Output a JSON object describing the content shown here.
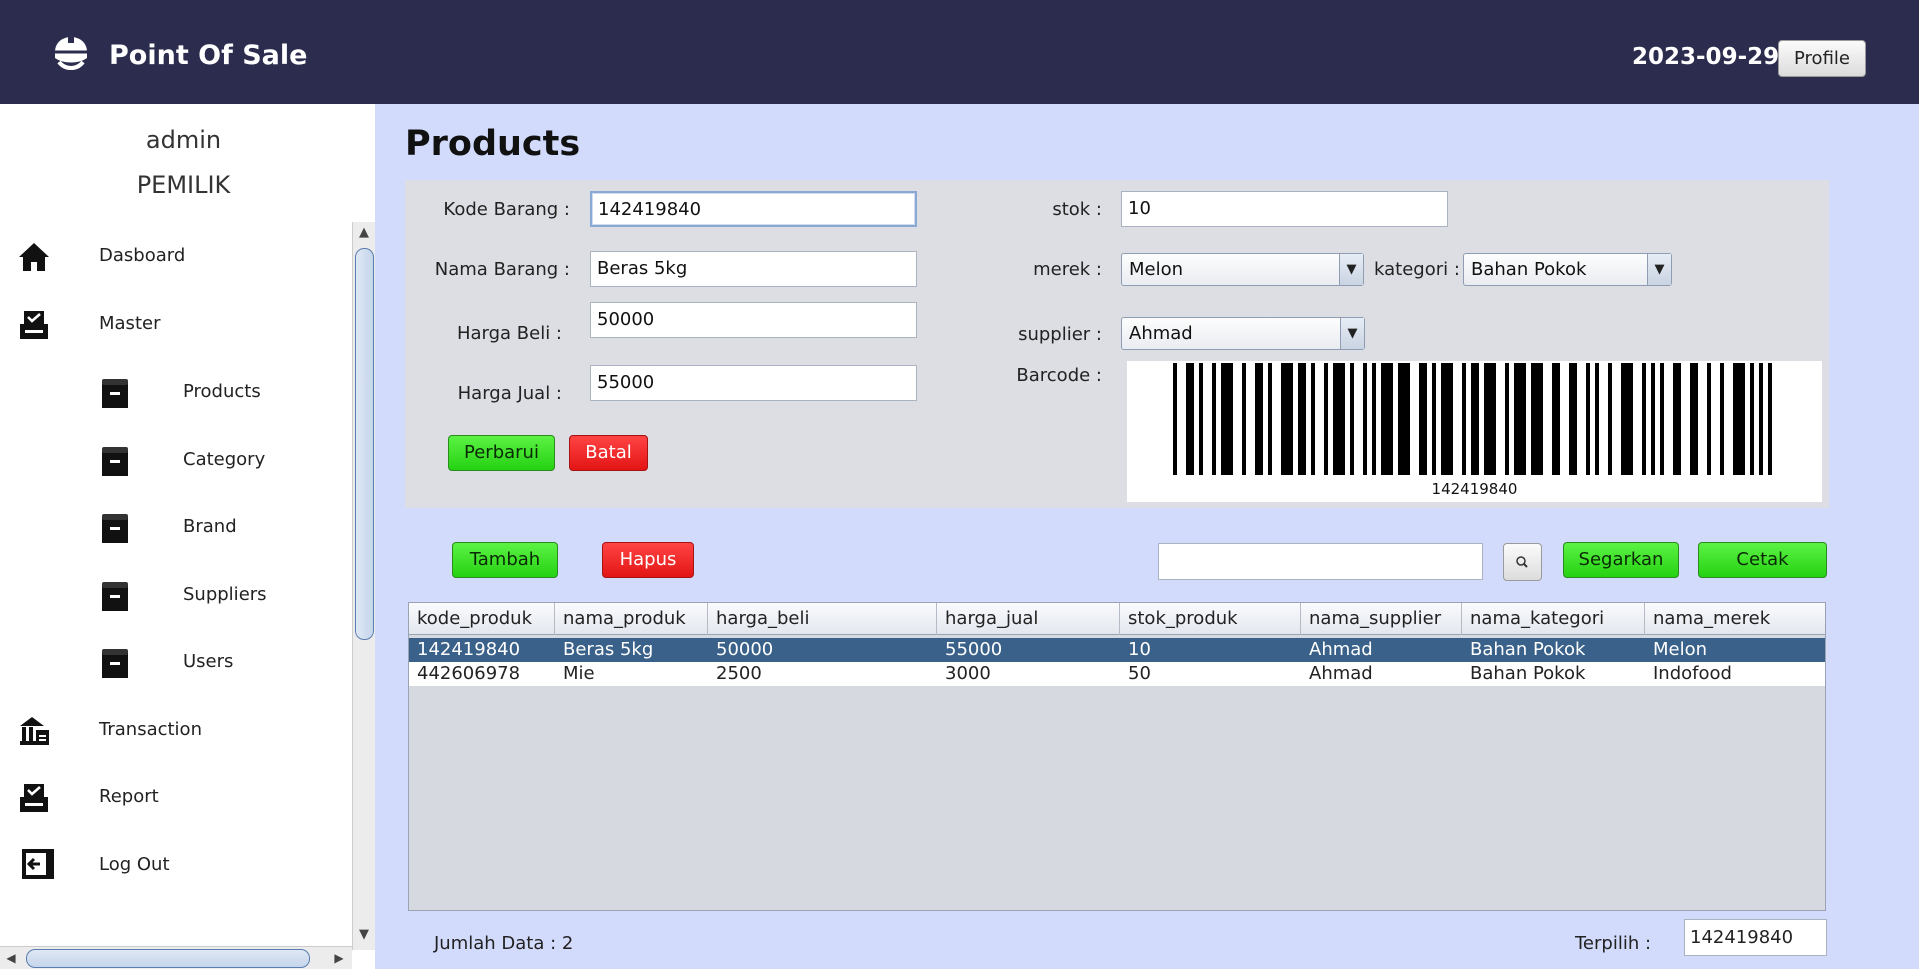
{
  "header": {
    "app_title": "Point Of Sale",
    "date": "2023-09-29",
    "profile_label": "Profile"
  },
  "sidebar": {
    "user_name": "admin",
    "user_role": "PEMILIK",
    "items": [
      {
        "label": "Dasboard",
        "icon": "home-icon"
      },
      {
        "label": "Master",
        "icon": "master-icon"
      },
      {
        "label": "Products",
        "icon": "box-icon"
      },
      {
        "label": "Category",
        "icon": "box-icon"
      },
      {
        "label": "Brand",
        "icon": "box-icon"
      },
      {
        "label": "Suppliers",
        "icon": "box-icon"
      },
      {
        "label": "Users",
        "icon": "box-icon"
      },
      {
        "label": "Transaction",
        "icon": "transaction-icon"
      },
      {
        "label": "Report",
        "icon": "report-icon"
      },
      {
        "label": "Log Out",
        "icon": "logout-icon"
      }
    ]
  },
  "page_title": "Products",
  "form": {
    "kode_label": "Kode Barang :",
    "kode_value": "142419840",
    "nama_label": "Nama Barang :",
    "nama_value": "Beras 5kg",
    "harga_beli_label": "Harga Beli :",
    "harga_beli_value": "50000",
    "harga_jual_label": "Harga Jual :",
    "harga_jual_value": "55000",
    "stok_label": "stok :",
    "stok_value": "10",
    "merek_label": "merek :",
    "merek_value": "Melon",
    "kategori_label": "kategori :",
    "kategori_value": "Bahan Pokok",
    "supplier_label": "supplier :",
    "supplier_value": "Ahmad",
    "barcode_label": "Barcode :",
    "barcode_value": "142419840",
    "perbarui_label": "Perbarui",
    "batal_label": "Batal"
  },
  "toolbar": {
    "tambah_label": "Tambah",
    "hapus_label": "Hapus",
    "search_value": "",
    "segarkan_label": "Segarkan",
    "cetak_label": "Cetak"
  },
  "table": {
    "columns": [
      "kode_produk",
      "nama_produk",
      "harga_beli",
      "harga_jual",
      "stok_produk",
      "nama_supplier",
      "nama_kategori",
      "nama_merek"
    ],
    "rows": [
      [
        "142419840",
        "Beras 5kg",
        "50000",
        "55000",
        "10",
        "Ahmad",
        "Bahan Pokok",
        "Melon"
      ],
      [
        "442606978",
        "Mie",
        "2500",
        "3000",
        "50",
        "Ahmad",
        "Bahan Pokok",
        "Indofood"
      ]
    ]
  },
  "footer": {
    "count_label": "Jumlah Data : 2",
    "selected_label": "Terpilih :",
    "selected_value": "142419840"
  },
  "colors": {
    "header_bg": "#2c2c4f",
    "main_bg": "#d2dbfc",
    "panel_bg": "#dcdee4",
    "green_button": "#25d212",
    "red_button": "#e31515",
    "selected_row": "#3a6189"
  }
}
